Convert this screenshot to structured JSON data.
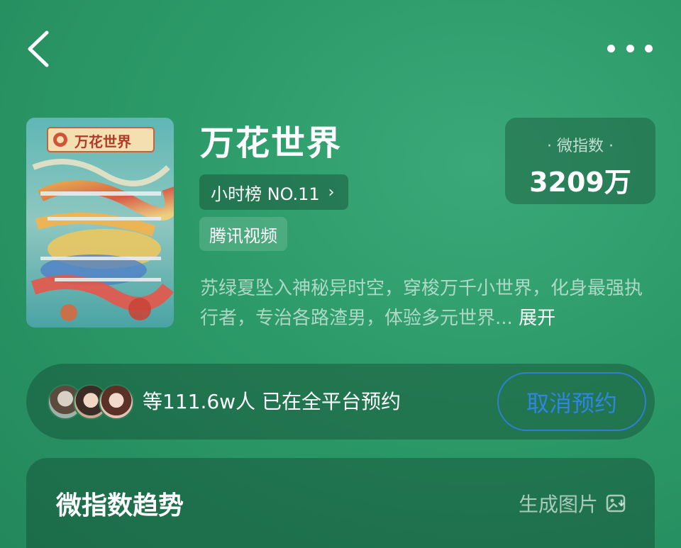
{
  "nav": {
    "back_icon": "chevron-left-icon",
    "more_icon": "more-horizontal-icon"
  },
  "show": {
    "title": "万花世界",
    "poster_logo_text": "万花世界",
    "rank_label": "小时榜 NO.11",
    "rank_chevron": "›",
    "platform": "腾讯视频",
    "description": "苏绿夏坠入神秘异时空，穿梭万千小世界，化身最强执行者，专治各路渣男，体验多元世界...",
    "expand_label": "展开"
  },
  "index_card": {
    "label": "· 微指数 ·",
    "value": "3209万"
  },
  "reservation": {
    "text": "等111.6w人 已在全平台预约",
    "button_label": "取消预约"
  },
  "trend": {
    "title": "微指数趋势",
    "generate_label": "生成图片",
    "generate_icon": "image-export-icon"
  },
  "colors": {
    "background": "#2c9a68",
    "button_blue": "#2f85e0"
  }
}
